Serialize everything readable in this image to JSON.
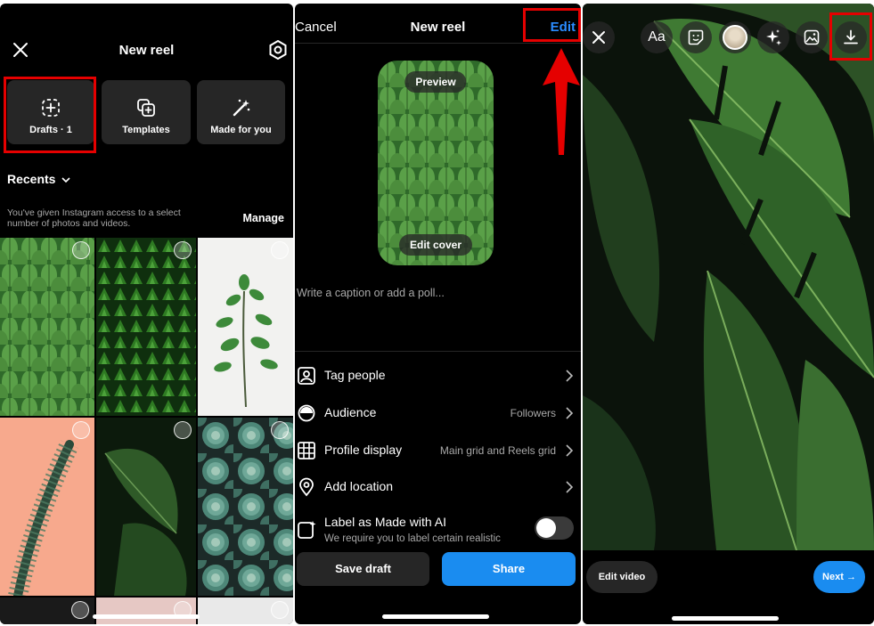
{
  "panel1": {
    "title": "New reel",
    "close_icon": "close-icon",
    "settings_icon": "settings-icon",
    "tiles": [
      {
        "label": "Drafts · 1",
        "icon": "drafts-icon"
      },
      {
        "label": "Templates",
        "icon": "templates-icon"
      },
      {
        "label": "Made for you",
        "icon": "magic-wand-icon"
      }
    ],
    "recents_label": "Recents",
    "notice": "You've given Instagram access to a select number of photos and videos.",
    "manage_label": "Manage"
  },
  "panel2": {
    "cancel_label": "Cancel",
    "title": "New reel",
    "edit_label": "Edit",
    "preview_label": "Preview",
    "edit_cover_label": "Edit cover",
    "caption_placeholder": "Write a caption or add a poll...",
    "rows": [
      {
        "label": "Tag people",
        "value": "",
        "icon": "tag-people-icon"
      },
      {
        "label": "Audience",
        "value": "Followers",
        "icon": "audience-icon"
      },
      {
        "label": "Profile display",
        "value": "Main grid and Reels grid",
        "icon": "grid-icon"
      },
      {
        "label": "Add location",
        "value": "",
        "icon": "location-pin-icon"
      }
    ],
    "ai_label": "Label as Made with AI",
    "ai_sub": "We require you to label certain realistic",
    "ai_toggle_on": false,
    "save_draft_label": "Save draft",
    "share_label": "Share"
  },
  "panel3": {
    "toolbar_icons": [
      "close-icon",
      "text-icon",
      "sticker-icon",
      "avatar",
      "effects-icon",
      "image-icon",
      "download-icon"
    ],
    "text_icon_glyph": "Aa",
    "edit_video_label": "Edit video",
    "next_label": "Next →"
  },
  "colors": {
    "accent_blue": "#1a8cf0",
    "highlight_red": "#e50000",
    "tile_bg": "#262626"
  }
}
